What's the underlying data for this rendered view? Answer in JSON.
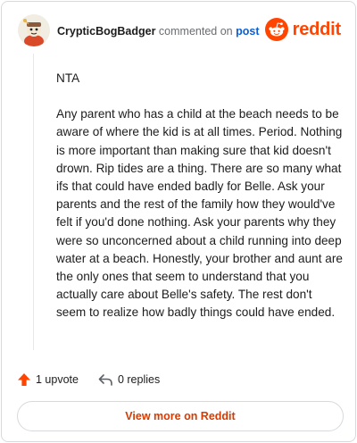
{
  "header": {
    "author": "CrypticBogBadger",
    "commented_text": "commented on",
    "post_link": "post",
    "brand_name": "reddit"
  },
  "comment": {
    "paragraph_1": "NTA",
    "paragraph_2": "Any parent who has a child at the beach needs to be aware of where the kid is at all times. Period. Nothing is more important than making sure that kid doesn't drown. Rip tides are a thing. There are so many what ifs that could have ended badly for Belle. Ask your parents and the rest of the family how they would've felt if you'd done nothing. Ask your parents why they were so unconcerned about a child running into deep water at a beach. Honestly, your brother and aunt are the only ones that seem to understand that you actually care about Belle's safety. The rest don't seem to realize how badly things could have ended."
  },
  "actions": {
    "upvote_label": "1 upvote",
    "replies_label": "0 replies"
  },
  "footer": {
    "view_more_label": "View more on Reddit"
  },
  "icons": {
    "upvote": "upvote-arrow-icon",
    "reply": "reply-arrow-icon",
    "brand": "reddit-snoo-icon"
  },
  "colors": {
    "brand_orange": "#ff4500",
    "link_blue": "#0b5fd8",
    "view_more_text": "#d93a00",
    "upvote_orange": "#ff4500"
  }
}
